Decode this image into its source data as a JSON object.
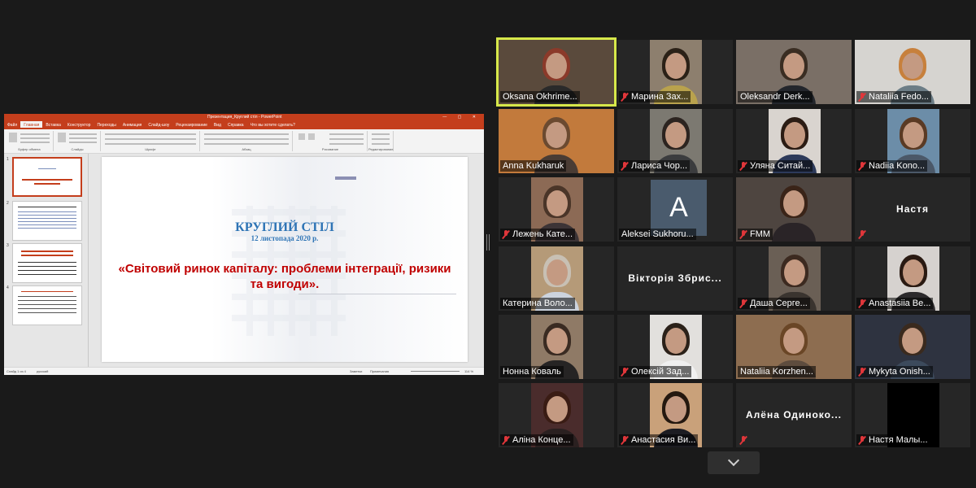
{
  "app": {
    "name": "Zoom meeting gallery view with shared screen"
  },
  "powerpoint": {
    "title": "Презентация_Круглий стіл  -  PowerPoint",
    "tabs": [
      "Файл",
      "Главная",
      "Вставка",
      "Конструктор",
      "Переходы",
      "Анимация",
      "Слайд-шоу",
      "Рецензирование",
      "Вид",
      "Справка",
      "Что вы хотите сделать?"
    ],
    "ribbon_groups": [
      "Буфер обмена",
      "Слайды",
      "Шрифт",
      "Абзац",
      "Рисование",
      "Редактирование"
    ],
    "thumb_numbers": [
      "1",
      "2",
      "3",
      "4"
    ],
    "slide": {
      "title": "КРУГЛИЙ СТІЛ",
      "date": "12 листопада 2020 р.",
      "main_text": "«Світовий ринок капіталу: проблеми інтеграції, ризики та вигоди»."
    },
    "status": {
      "slide_count": "Слайд 1 из 4",
      "language": "русский",
      "notes": "Заметки",
      "comments": "Примечания",
      "zoom": "114 %"
    }
  },
  "participants": [
    {
      "name": "Oksana Okhrime...",
      "muted": false,
      "type": "video",
      "speaking": true,
      "bg": "#5a4a3c",
      "body": "#2a2a2a",
      "hair": "#8b3a2a"
    },
    {
      "name": "Марина Зах...",
      "muted": true,
      "type": "video",
      "bg": "#8d7f6e",
      "body": "#b9a24d",
      "hair": "#2b2117"
    },
    {
      "name": "Oleksandr Derk...",
      "muted": false,
      "type": "video",
      "bg": "#7a6f66",
      "body": "#23262c",
      "hair": "#3a2d22"
    },
    {
      "name": "Nataliia Fedo...",
      "muted": true,
      "type": "video",
      "bg": "#d6d4d0",
      "body": "#6c7d86",
      "hair": "#c7803c"
    },
    {
      "name": "Anna Kukharuk",
      "muted": false,
      "type": "video",
      "bg": "#c27a3c",
      "body": "#4a3c34",
      "hair": "#6b4a30"
    },
    {
      "name": "Лариса Чор...",
      "muted": true,
      "type": "video",
      "bg": "#7c7971",
      "body": "#3b3c3e",
      "hair": "#2c2420"
    },
    {
      "name": "Уляна Ситай...",
      "muted": true,
      "type": "video",
      "bg": "#d9d4cf",
      "body": "#2d3a5a",
      "hair": "#2b1c14"
    },
    {
      "name": "Nadiia Kono...",
      "muted": true,
      "type": "video",
      "bg": "#6c8da8",
      "body": "#4b5868",
      "hair": "#5a3a24"
    },
    {
      "name": "Лежень Кате...",
      "muted": true,
      "type": "video",
      "bg": "#8c6a55",
      "body": "#3c3436",
      "hair": "#4a3528"
    },
    {
      "name": "Aleksei Sukhoru...",
      "muted": false,
      "type": "avatar",
      "initial": "A"
    },
    {
      "name": "FMM",
      "muted": true,
      "type": "video",
      "bg": "#4e4540",
      "body": "#2a2427",
      "hair": "#3a2418"
    },
    {
      "name": "Настя",
      "muted": true,
      "type": "text"
    },
    {
      "name": "Катерина Воло...",
      "muted": false,
      "type": "video",
      "bg": "#b59a78",
      "body": "#ccd3de",
      "hair": "#c8c0b4"
    },
    {
      "name": "Вікторія Збрис...",
      "muted": false,
      "type": "text"
    },
    {
      "name": "Даша Серге...",
      "muted": true,
      "type": "video",
      "bg": "#6a5f55",
      "body": "#3a342f",
      "hair": "#3c2a20"
    },
    {
      "name": "Anastasiia Be...",
      "muted": true,
      "type": "video",
      "bg": "#d6d2cf",
      "body": "#2c2a2c",
      "hair": "#2a1a12"
    },
    {
      "name": "Нонна Коваль",
      "muted": false,
      "type": "video",
      "bg": "#8f7a66",
      "body": "#262424",
      "hair": "#3a2b22"
    },
    {
      "name": "Олексій Зад...",
      "muted": true,
      "type": "video",
      "bg": "#e2e0dd",
      "body": "#f0f0f0",
      "hair": "#2b2119"
    },
    {
      "name": "Nataliia Korzhen...",
      "muted": false,
      "type": "video",
      "bg": "#8d6d50",
      "body": "#5e4c3e",
      "hair": "#6a4626"
    },
    {
      "name": "Mykyta Onish...",
      "muted": true,
      "type": "video",
      "bg": "#2e3340",
      "body": "#3c4a5c",
      "hair": "#3a2a1e"
    },
    {
      "name": "Аліна Конце...",
      "muted": true,
      "type": "video",
      "bg": "#4a2c2c",
      "body": "#2a2020",
      "hair": "#3a1c14"
    },
    {
      "name": "Анастасия Ви...",
      "muted": true,
      "type": "video",
      "bg": "#c9a17a",
      "body": "#1c1c22",
      "hair": "#24180f"
    },
    {
      "name": "Алёна  Одиноко...",
      "muted": true,
      "type": "text"
    },
    {
      "name": "Настя Малы...",
      "muted": true,
      "type": "video",
      "bg": "#000000",
      "body": "#000000",
      "hair": "#000000"
    }
  ],
  "icons": {
    "muted": "mic-muted-icon",
    "scroll": "chevron-down-icon"
  }
}
